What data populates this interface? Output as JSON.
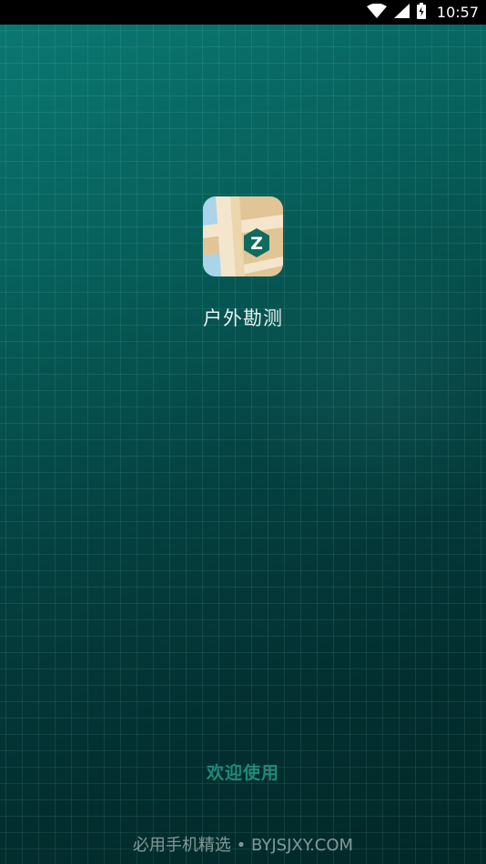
{
  "status_bar": {
    "time": "10:57",
    "icons": [
      "wifi-icon",
      "cellular-signal-icon",
      "battery-icon"
    ]
  },
  "splash": {
    "app_icon": {
      "name": "map-app-icon",
      "badge_letter": "Z"
    },
    "app_name": "户外勘测",
    "welcome_text": "欢迎使用"
  },
  "watermark": {
    "text": "必用手机精选 • BYJSJXY.COM"
  },
  "colors": {
    "background_top": "#0b7a73",
    "background_bottom": "#022828",
    "welcome_text": "#1f8a7c",
    "badge_green": "#0f6b5e",
    "map_beige": "#e2c596",
    "map_road": "#f4e6cc",
    "map_water": "#a9d4ea"
  }
}
